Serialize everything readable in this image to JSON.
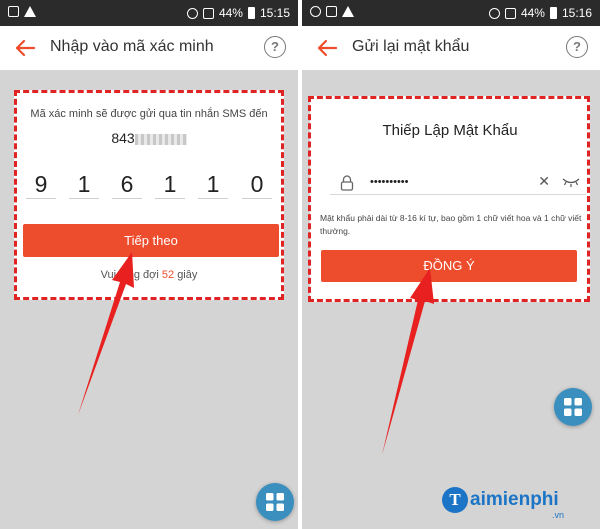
{
  "left_screen": {
    "status": {
      "battery": "44%",
      "time": "15:15"
    },
    "appbar": {
      "title": "Nhập vào mã xác minh"
    },
    "info_text": "Mã xác minh sẽ được gửi qua tin nhắn SMS đến",
    "phone_prefix": "843",
    "digits": [
      "9",
      "1",
      "6",
      "1",
      "1",
      "0"
    ],
    "next_button": "Tiếp theo",
    "wait_prefix": "Vui lòng đợi",
    "wait_seconds": "52",
    "wait_suffix": "giây"
  },
  "right_screen": {
    "status": {
      "battery": "44%",
      "time": "15:16"
    },
    "appbar": {
      "title": "Gửi lại mật khẩu"
    },
    "form_title": "Thiếp Lập Mật Khẩu",
    "password_value": "••••••••••",
    "password_rule": "Mật khẩu phải dài từ 8-16 kí tự, bao gồm 1 chữ viết hoa và 1 chữ viết thường.",
    "confirm_button": "ĐỒNG Ý"
  },
  "watermark": {
    "brand": "aimienphi",
    "brand_initial": "T",
    "suffix": ".vn"
  },
  "colors": {
    "accent": "#ee4d2d",
    "annotation": "#e02424",
    "fab": "#3a8fbf",
    "logo": "#1b74c5"
  },
  "icons": [
    "back-arrow-icon",
    "help-icon",
    "lock-icon",
    "clear-icon",
    "eye-closed-icon",
    "grid-menu-icon"
  ]
}
